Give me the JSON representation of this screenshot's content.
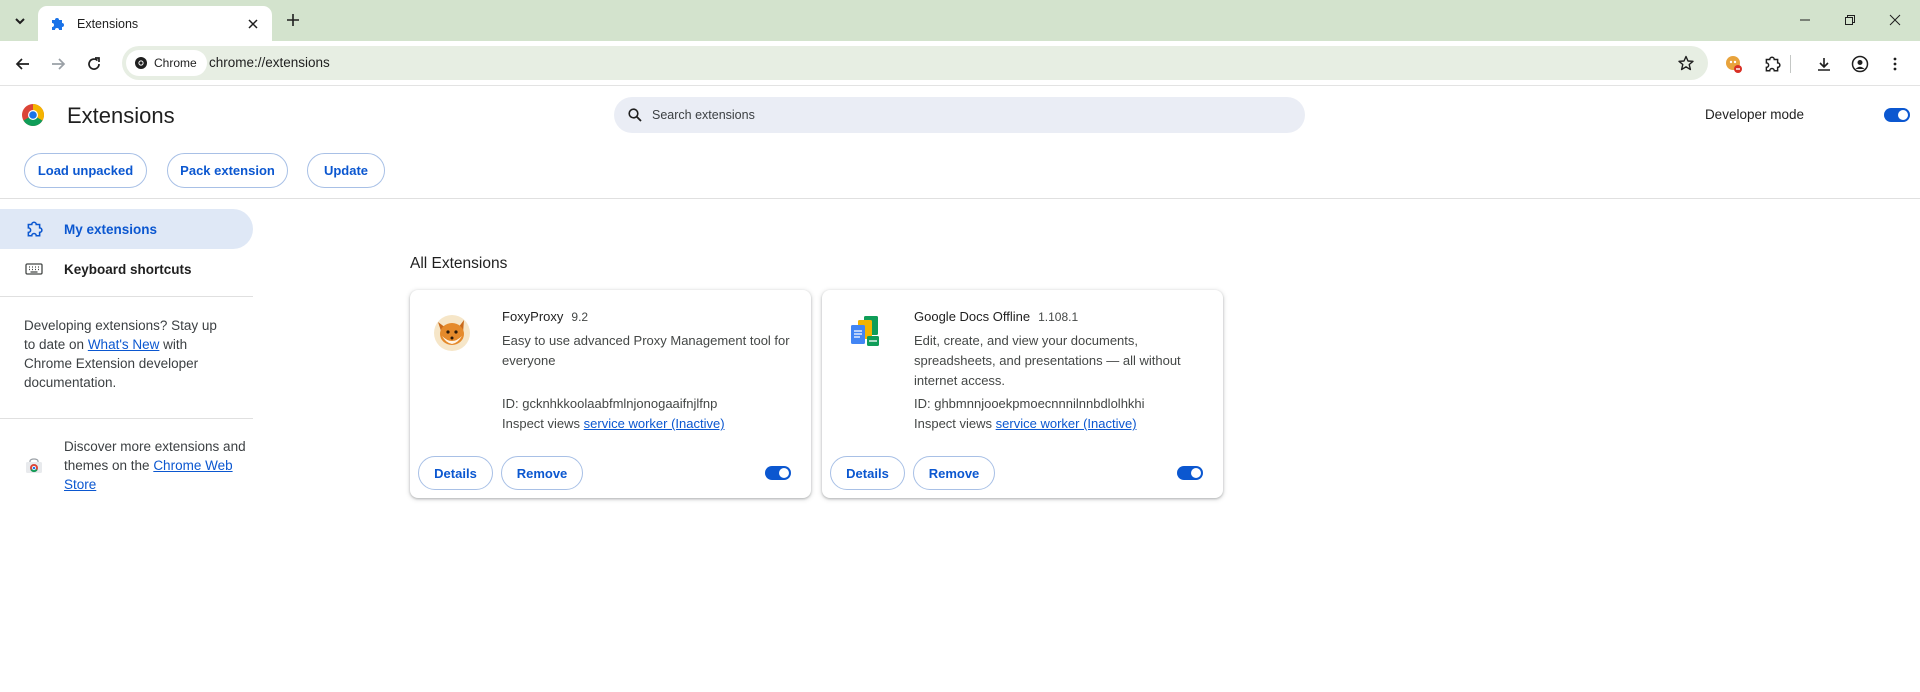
{
  "browser": {
    "tab_title": "Extensions",
    "omnibox_chip": "Chrome",
    "url": "chrome://extensions"
  },
  "header": {
    "title": "Extensions",
    "search_placeholder": "Search extensions",
    "developer_mode_label": "Developer mode",
    "developer_mode_on": true,
    "buttons": {
      "load_unpacked": "Load unpacked",
      "pack_extension": "Pack extension",
      "update": "Update"
    }
  },
  "sidebar": {
    "items": [
      {
        "label": "My extensions",
        "icon": "extension-icon",
        "active": true
      },
      {
        "label": "Keyboard shortcuts",
        "icon": "keyboard-icon",
        "active": false
      }
    ],
    "dev_text_before": "Developing extensions? Stay up to date on ",
    "dev_link": "What's New",
    "dev_text_after": " with Chrome Extension developer documentation.",
    "store_text_before": "Discover more extensions and themes on the ",
    "store_link": "Chrome Web Store"
  },
  "main": {
    "section_title": "All Extensions",
    "extensions": [
      {
        "name": "FoxyProxy",
        "version": "9.2",
        "description": "Easy to use advanced Proxy Management tool for everyone",
        "id": "ID: gcknhkkoolaabfmlnjonogaaifnjlfnp",
        "inspect_label": "Inspect views ",
        "inspect_link": "service worker (Inactive)",
        "details_label": "Details",
        "remove_label": "Remove",
        "enabled": true
      },
      {
        "name": "Google Docs Offline",
        "version": "1.108.1",
        "description": "Edit, create, and view your documents, spreadsheets, and presentations — all without internet access.",
        "id": "ID: ghbmnnjooekpmoecnnnilnnbdlolhkhi",
        "inspect_label": "Inspect views ",
        "inspect_link": "service worker (Inactive)",
        "details_label": "Details",
        "remove_label": "Remove",
        "enabled": true
      }
    ]
  },
  "colors": {
    "accent": "#0b57d0",
    "tabstrip": "#d3e3cd",
    "omnibox": "#e7eee3",
    "search_bg": "#eaedf5",
    "active_nav": "#dfe8f6"
  }
}
